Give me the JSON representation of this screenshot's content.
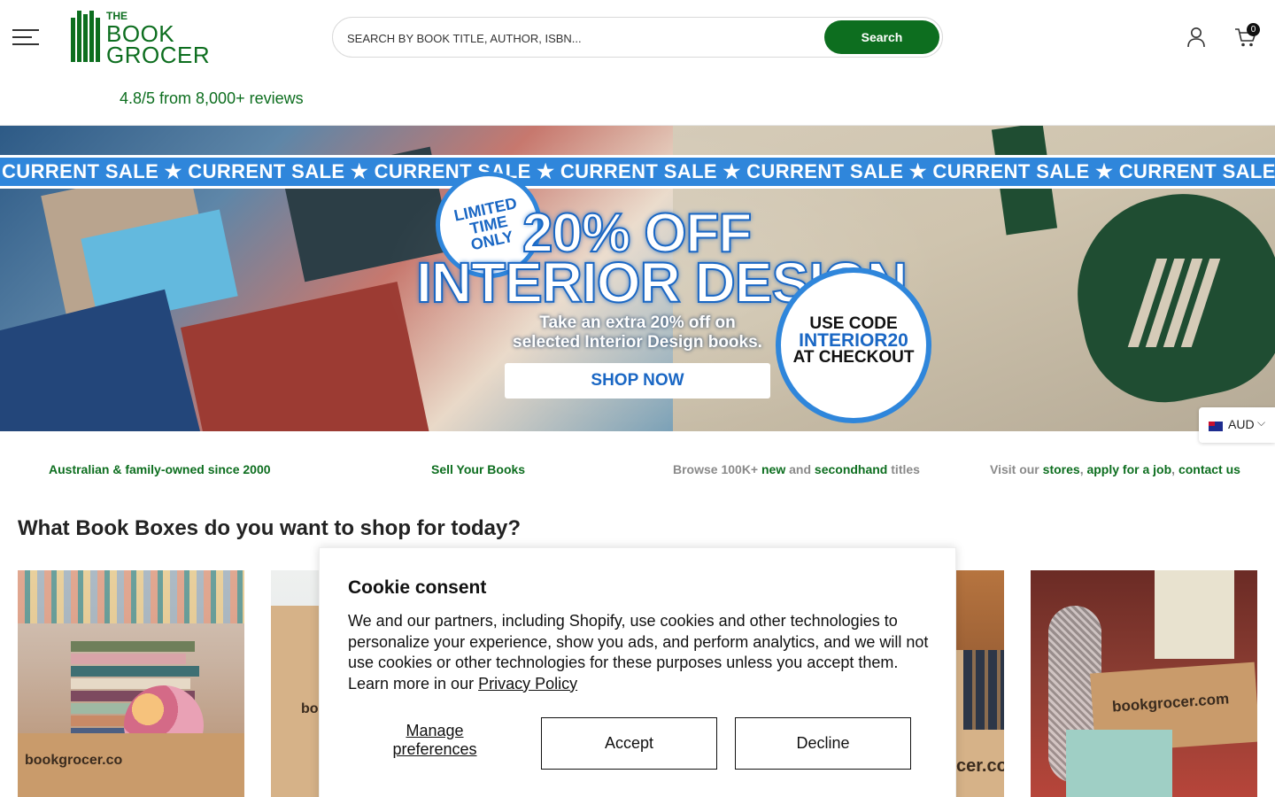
{
  "header": {
    "logo": {
      "line1": "THE",
      "line2": "BOOK",
      "line3": "GROCER"
    },
    "reviews": "4.8/5 from 8,000+ reviews",
    "search": {
      "placeholder": "SEARCH BY BOOK TITLE, AUTHOR, ISBN...",
      "button_label": "Search"
    },
    "cart_count": "0",
    "brand_color": "#0d6e1f"
  },
  "banner": {
    "ticker": "CURRENT SALE ★ CURRENT SALE ★ CURRENT SALE ★ CURRENT SALE ★ CURRENT SALE ★ CURRENT SALE ★ CURRENT SALE ★ CURRENT SALE",
    "limited_line1": "LIMITED",
    "limited_line2": "TIME",
    "limited_line3": "ONLY",
    "headline_1": "20% OFF",
    "headline_2": "INTERIOR DESIGN",
    "sub_line1": "Take an extra 20% off on",
    "sub_line2": "selected Interior Design books.",
    "cta": "SHOP NOW",
    "code_line1": "USE CODE",
    "code_line2": "INTERIOR20",
    "code_line3": "AT CHECKOUT",
    "accent_color": "#2f86db"
  },
  "currency": {
    "label": "AUD",
    "chevron": "⌵"
  },
  "usp": {
    "item1": "Australian & family-owned since 2000",
    "item2": "Sell Your Books",
    "item3": {
      "prefix": "Browse 100K+ ",
      "link1": "new",
      "middle": " and ",
      "link2": "secondhand",
      "suffix": " titles"
    },
    "item4": {
      "prefix": "Visit our ",
      "link1": "stores",
      "sep1": ", ",
      "link2": "apply for a job",
      "sep2": ", ",
      "link3": "contact us"
    }
  },
  "section": {
    "title": "What Book Boxes do you want to shop for today?"
  },
  "tiles": {
    "tile1_text": "bookgrocer.co",
    "tile2_text": "bo",
    "tile3_text": "cer.co",
    "tile4_text": "bookgrocer.com"
  },
  "cookie": {
    "title": "Cookie consent",
    "body": "We and our partners, including Shopify, use cookies and other technologies to personalize your experience, show you ads, and perform analytics, and we will not use cookies or other technologies for these purposes unless you accept them. Learn more in our ",
    "privacy_link": "Privacy Policy",
    "manage_label": "Manage preferences",
    "accept_label": "Accept",
    "decline_label": "Decline"
  }
}
